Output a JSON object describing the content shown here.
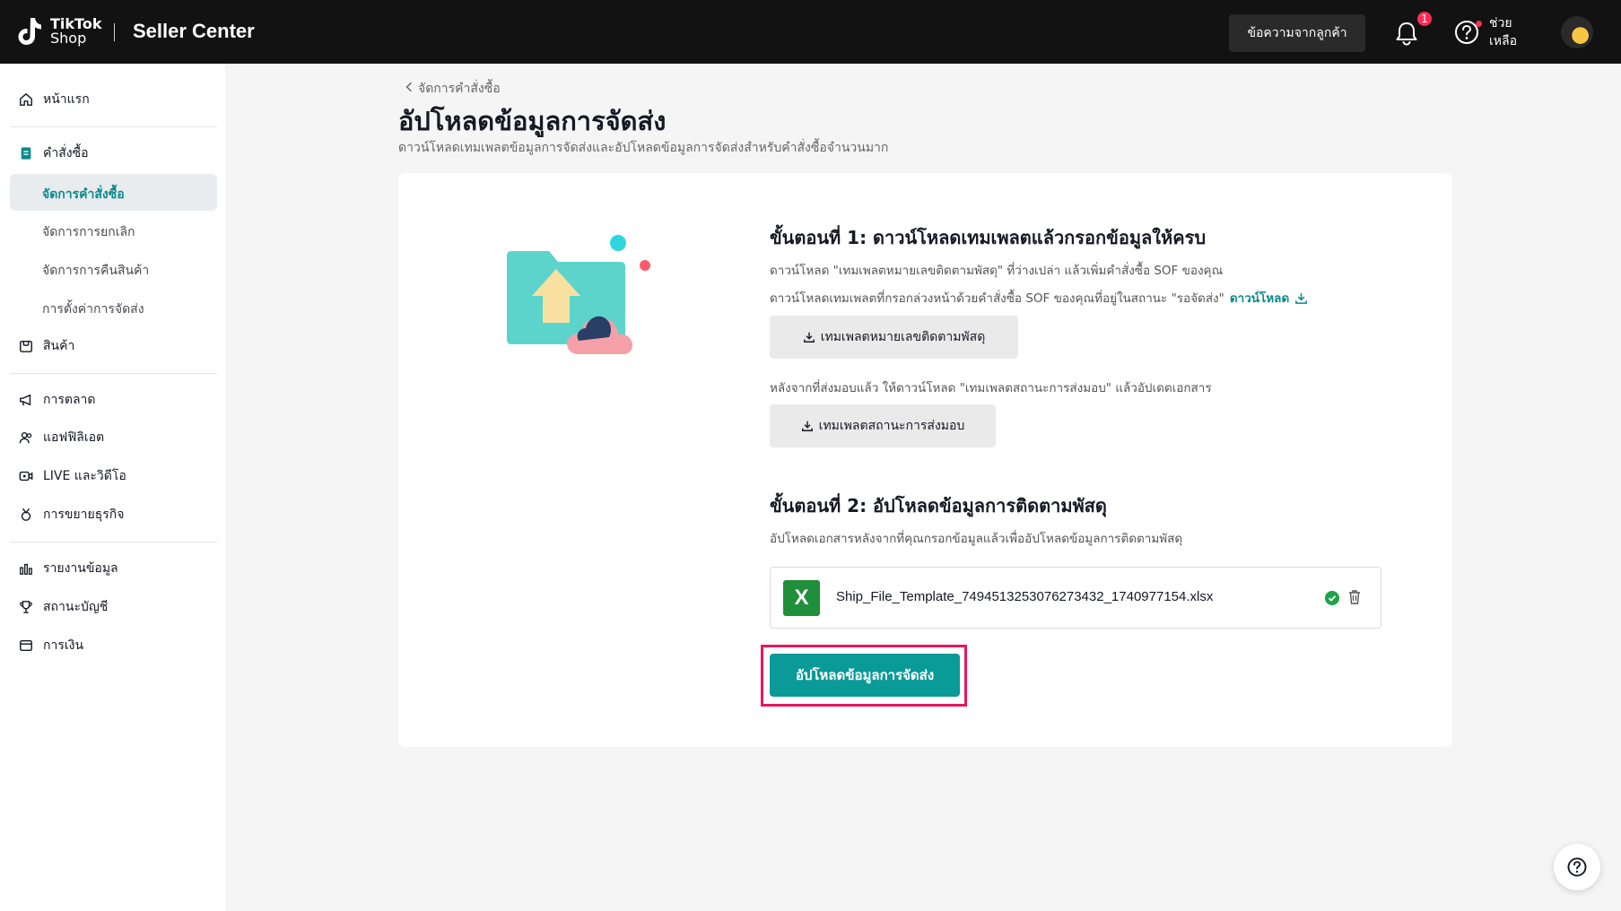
{
  "header": {
    "brand_line1": "TikTok",
    "brand_line2": "Shop",
    "app_title": "Seller Center",
    "customer_messages": "ข้อความจากลูกค้า",
    "notification_count": "1",
    "help_label": "ช่วยเหลือ"
  },
  "sidebar": {
    "home": "หน้าแรก",
    "orders": "คำสั่งซื้อ",
    "orders_sub": [
      "จัดการคำสั่งซื้อ",
      "จัดการการยกเลิก",
      "จัดการการคืนสินค้า",
      "การตั้งค่าการจัดส่ง"
    ],
    "products": "สินค้า",
    "marketing": "การตลาด",
    "affiliate": "แอฟฟิลิเอต",
    "live_video": "LIVE และวิดีโอ",
    "growth": "การขยายธุรกิจ",
    "reports": "รายงานข้อมูล",
    "account_health": "สถานะบัญชี",
    "finance": "การเงิน"
  },
  "main": {
    "breadcrumb": "จัดการคำสั่งซื้อ",
    "title": "อัปโหลดข้อมูลการจัดส่ง",
    "description": "ดาวน์โหลดเทมเพลตข้อมูลการจัดส่งและอัปโหลดข้อมูลการจัดส่งสำหรับคำสั่งซื้อจำนวนมาก",
    "step1": {
      "title": "ขั้นตอนที่ 1: ดาวน์โหลดเทมเพลตแล้วกรอกข้อมูลให้ครบ",
      "line1": "ดาวน์โหลด \"เทมเพลตหมายเลขติดตามพัสดุ\" ที่ว่างเปล่า แล้วเพิ่มคำสั่งซื้อ SOF ของคุณ",
      "line2": "ดาวน์โหลดเทมเพลตที่กรอกล่วงหน้าด้วยคำสั่งซื้อ SOF ของคุณที่อยู่ในสถานะ \"รอจัดส่ง\"",
      "download_link": "ดาวน์โหลด",
      "tracking_template_btn": "เทมเพลตหมายเลขติดตามพัสดุ",
      "line3": "หลังจากที่ส่งมอบแล้ว ให้ดาวน์โหลด \"เทมเพลตสถานะการส่งมอบ\" แล้วอัปเดตเอกสาร",
      "handover_template_btn": "เทมเพลตสถานะการส่งมอบ"
    },
    "step2": {
      "title": "ขั้นตอนที่ 2: อัปโหลดข้อมูลการติดตามพัสดุ",
      "desc": "อัปโหลดเอกสารหลังจากที่คุณกรอกข้อมูลแล้วเพื่ออัปโหลดข้อมูลการติดตามพัสดุ",
      "file_icon": "X",
      "file_name": "Ship_File_Template_7494513253076273432_1740977154.xlsx",
      "upload_btn": "อัปโหลดข้อมูลการจัดส่ง"
    }
  },
  "colors": {
    "accent": "#0a9a98",
    "highlight": "#e8185c",
    "header_bg": "#121212"
  }
}
